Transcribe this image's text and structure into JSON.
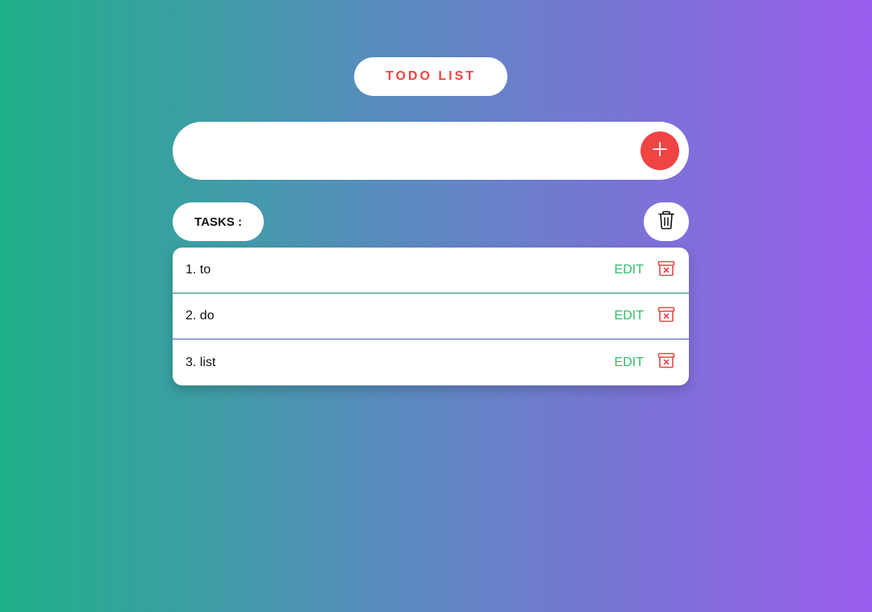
{
  "header": {
    "title": "TODO LIST"
  },
  "input": {
    "value": "",
    "placeholder": ""
  },
  "tasks_header": {
    "label": "TASKS :"
  },
  "tasks": [
    {
      "text": "1. to",
      "edit_label": "EDIT"
    },
    {
      "text": "2. do",
      "edit_label": "EDIT"
    },
    {
      "text": "3. list",
      "edit_label": "EDIT"
    }
  ],
  "icons": {
    "add": "plus-icon",
    "clear_all": "trash-icon",
    "delete": "archive-x-icon"
  },
  "colors": {
    "accent_red": "#ef4444",
    "edit_green": "#2fbf6a",
    "gradient_start": "#1fb189",
    "gradient_end": "#9a5cec"
  }
}
